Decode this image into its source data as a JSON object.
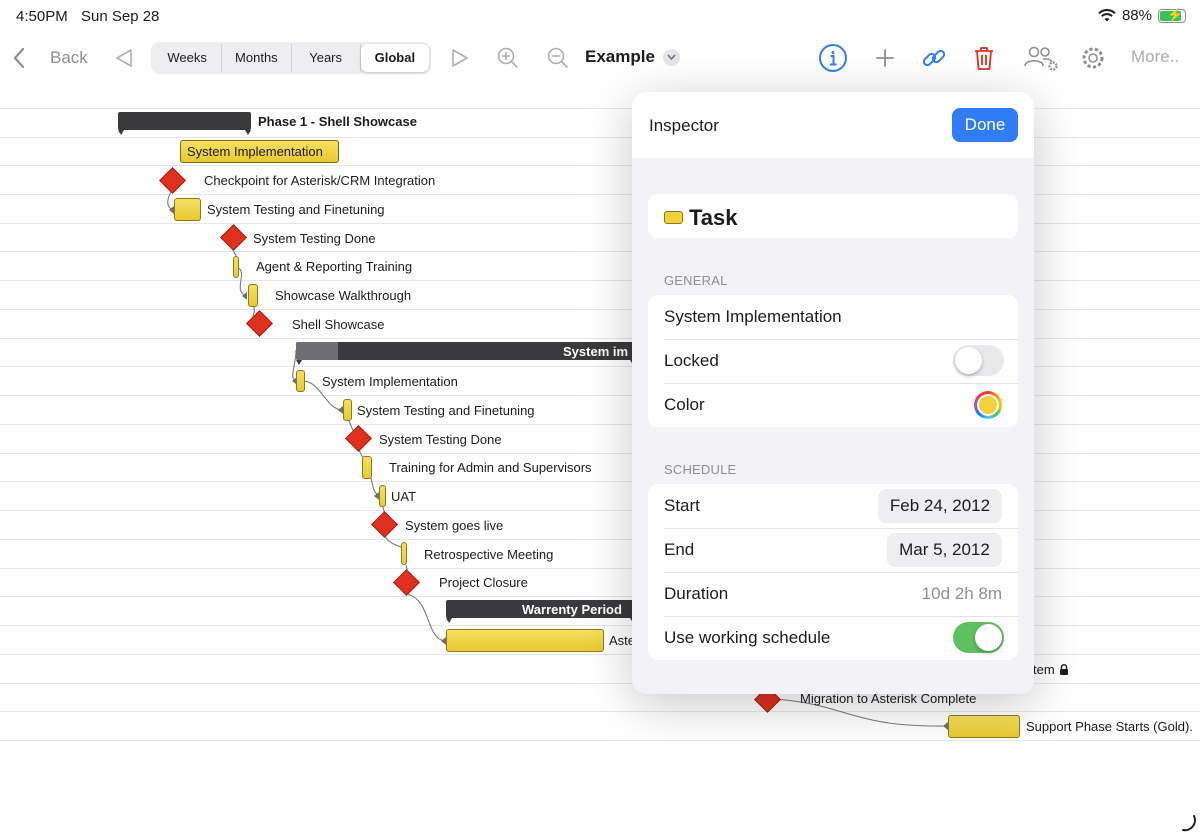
{
  "status_bar": {
    "time": "4:50PM",
    "date": "Sun Sep 28",
    "battery_percent": "88%",
    "battery_level": 0.88
  },
  "toolbar": {
    "back_label": "Back",
    "scale_segments": [
      {
        "label": "Weeks",
        "active": false
      },
      {
        "label": "Months",
        "active": false
      },
      {
        "label": "Years",
        "active": false
      },
      {
        "label": "Global",
        "active": true
      }
    ],
    "document_title": "Example",
    "more_label": "More..",
    "icons": [
      "chevron-left-icon",
      "triangle-left-icon",
      "triangle-right-icon",
      "zoom-in-icon",
      "zoom-out-icon",
      "info-icon",
      "plus-icon",
      "link-icon",
      "trash-icon",
      "people-settings-icon",
      "gear-icon"
    ],
    "accent_color": "#2f7cf6",
    "destructive_color": "#e0301e"
  },
  "gantt": {
    "rows": [
      {
        "label": "Phase 1 - Shell Showcase",
        "type": "phase"
      },
      {
        "label": "System Implementation",
        "type": "task-selected"
      },
      {
        "label": "Checkpoint for Asterisk/CRM Integration",
        "type": "milestone"
      },
      {
        "label": "System Testing and Finetuning",
        "type": "task"
      },
      {
        "label": "System Testing Done",
        "type": "milestone"
      },
      {
        "label": "Agent & Reporting Training",
        "type": "task"
      },
      {
        "label": "Showcase Walkthrough",
        "type": "task"
      },
      {
        "label": "Shell Showcase",
        "type": "milestone"
      },
      {
        "label": "System im",
        "type": "phase"
      },
      {
        "label": "System Implementation",
        "type": "task"
      },
      {
        "label": "System Testing and Finetuning",
        "type": "task"
      },
      {
        "label": "System Testing Done",
        "type": "milestone"
      },
      {
        "label": "Training for Admin and Supervisors",
        "type": "task"
      },
      {
        "label": "UAT",
        "type": "task"
      },
      {
        "label": "System goes live",
        "type": "milestone"
      },
      {
        "label": "Retrospective Meeting",
        "type": "task"
      },
      {
        "label": "Project Closure",
        "type": "milestone"
      },
      {
        "label": "Warrenty Period",
        "type": "phase"
      },
      {
        "label": "Aste",
        "type": "task"
      },
      {
        "label": "tem",
        "type": "task-locked"
      },
      {
        "label": "Migration to Asterisk Complete",
        "type": "milestone"
      },
      {
        "label": "Support Phase Starts (Gold).",
        "type": "task"
      }
    ],
    "task_color": "#f0d541",
    "milestone_color": "#e0301e",
    "phase_color": "#3a3a3c"
  },
  "inspector": {
    "title": "Inspector",
    "done_label": "Done",
    "item_type": "Task",
    "general_header": "GENERAL",
    "name_value": "System Implementation",
    "locked_label": "Locked",
    "locked": false,
    "color_label": "Color",
    "color_value": "#f2d13a",
    "schedule_header": "SCHEDULE",
    "start_label": "Start",
    "start_value": "Feb 24, 2012",
    "end_label": "End",
    "end_value": "Mar 5, 2012",
    "duration_label": "Duration",
    "duration_value": "10d 2h 8m",
    "working_schedule_label": "Use working schedule",
    "working_schedule": true
  }
}
